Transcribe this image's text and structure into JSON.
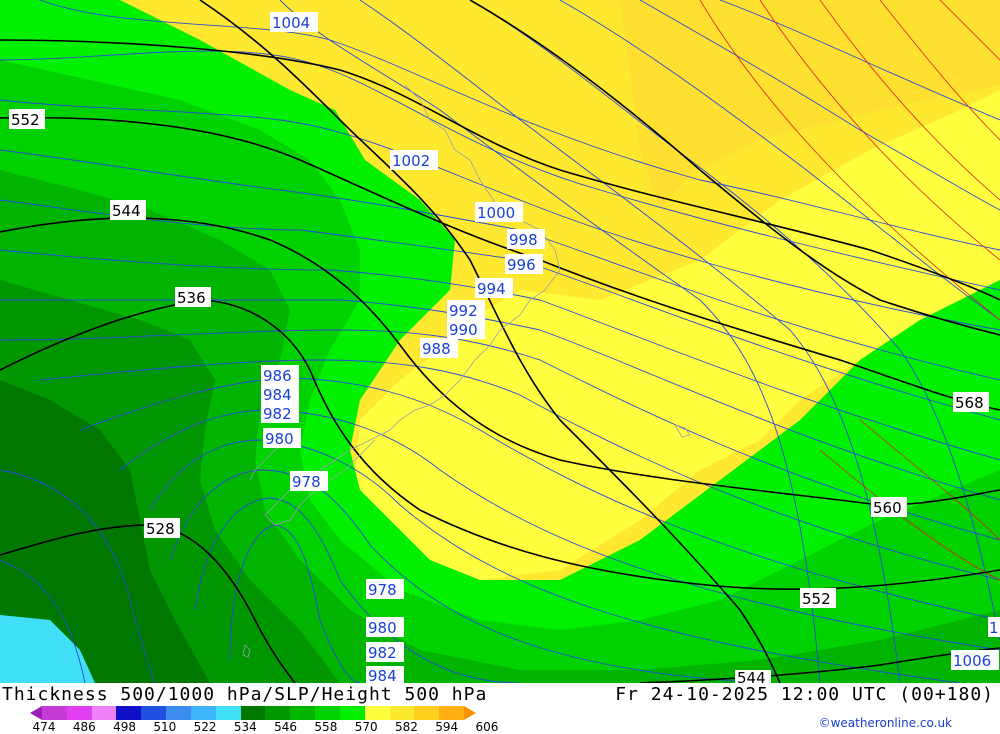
{
  "title": "Thickness 500/1000 hPa/SLP/Height 500 hPa",
  "datetime": "Fr 24-10-2025 12:00 UTC (00+180)",
  "credit": "©weatheronline.co.uk",
  "legend": {
    "ticks": [
      "474",
      "486",
      "498",
      "510",
      "522",
      "534",
      "546",
      "558",
      "570",
      "582",
      "594",
      "606"
    ],
    "colors": [
      "#9b1fb8",
      "#c63ad8",
      "#e040f0",
      "#f080f8",
      "#1010c8",
      "#2050e0",
      "#3c8cf0",
      "#40b4f8",
      "#40e0f8",
      "#007800",
      "#009600",
      "#00b400",
      "#00d200",
      "#00f000",
      "#ffff40",
      "#ffe830",
      "#ffd020",
      "#ffb010",
      "#ff9000"
    ]
  },
  "map": {
    "isobar_labels": [
      "1004",
      "1002",
      "1000",
      "998",
      "996",
      "994",
      "992",
      "990",
      "988",
      "986",
      "984",
      "982",
      "980",
      "978",
      "978",
      "980",
      "982",
      "984",
      "1006",
      "1"
    ],
    "thickness_labels": [
      "552",
      "544",
      "536",
      "528",
      "568",
      "560",
      "552",
      "544"
    ]
  }
}
